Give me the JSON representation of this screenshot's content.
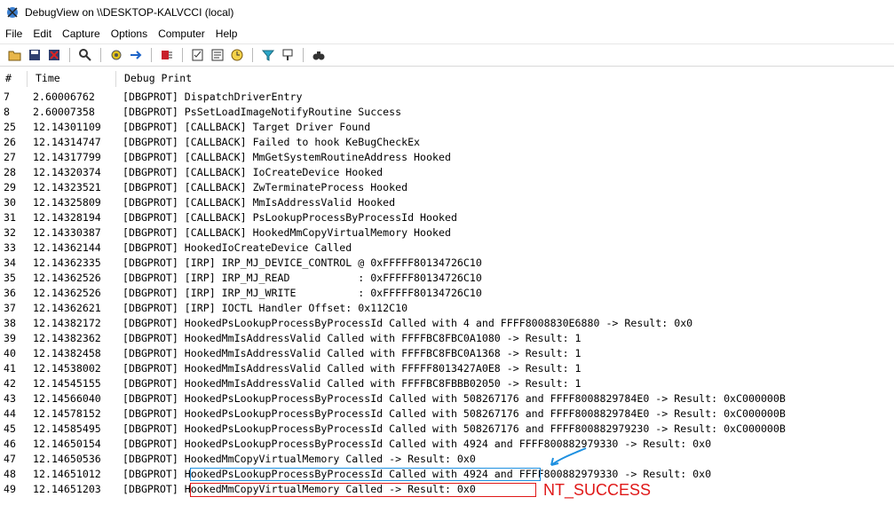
{
  "window": {
    "title": "DebugView on \\\\DESKTOP-KALVCCI (local)"
  },
  "menu": [
    "File",
    "Edit",
    "Capture",
    "Options",
    "Computer",
    "Help"
  ],
  "toolbar_icons": [
    "open-icon",
    "save-icon",
    "clear-icon",
    "find-icon",
    "capture-icon",
    "autoscroll-icon",
    "capture-kernel-icon",
    "clock-icon",
    "filter-icon",
    "highlight-icon",
    "binoculars-icon"
  ],
  "columns": {
    "num": "#",
    "time": "Time",
    "msg": "Debug Print"
  },
  "rows": [
    {
      "n": "7",
      "t": "2.60006762",
      "m": "[DBGPROT] DispatchDriverEntry"
    },
    {
      "n": "8",
      "t": "2.60007358",
      "m": "[DBGPROT] PsSetLoadImageNotifyRoutine Success"
    },
    {
      "n": "25",
      "t": "12.14301109",
      "m": "[DBGPROT] [CALLBACK] Target Driver Found"
    },
    {
      "n": "26",
      "t": "12.14314747",
      "m": "[DBGPROT] [CALLBACK] Failed to hook KeBugCheckEx"
    },
    {
      "n": "27",
      "t": "12.14317799",
      "m": "[DBGPROT] [CALLBACK] MmGetSystemRoutineAddress Hooked"
    },
    {
      "n": "28",
      "t": "12.14320374",
      "m": "[DBGPROT] [CALLBACK] IoCreateDevice Hooked"
    },
    {
      "n": "29",
      "t": "12.14323521",
      "m": "[DBGPROT] [CALLBACK] ZwTerminateProcess Hooked"
    },
    {
      "n": "30",
      "t": "12.14325809",
      "m": "[DBGPROT] [CALLBACK] MmIsAddressValid Hooked"
    },
    {
      "n": "31",
      "t": "12.14328194",
      "m": "[DBGPROT] [CALLBACK] PsLookupProcessByProcessId Hooked"
    },
    {
      "n": "32",
      "t": "12.14330387",
      "m": "[DBGPROT] [CALLBACK] HookedMmCopyVirtualMemory Hooked"
    },
    {
      "n": "33",
      "t": "12.14362144",
      "m": "[DBGPROT] HookedIoCreateDevice Called"
    },
    {
      "n": "34",
      "t": "12.14362335",
      "m": "[DBGPROT] [IRP] IRP_MJ_DEVICE_CONTROL @ 0xFFFFF80134726C10"
    },
    {
      "n": "35",
      "t": "12.14362526",
      "m": "[DBGPROT] [IRP] IRP_MJ_READ           : 0xFFFFF80134726C10"
    },
    {
      "n": "36",
      "t": "12.14362526",
      "m": "[DBGPROT] [IRP] IRP_MJ_WRITE          : 0xFFFFF80134726C10"
    },
    {
      "n": "37",
      "t": "12.14362621",
      "m": "[DBGPROT] [IRP] IOCTL Handler Offset: 0x112C10"
    },
    {
      "n": "38",
      "t": "12.14382172",
      "m": "[DBGPROT] HookedPsLookupProcessByProcessId Called with 4 and FFFF8008830E6880 -> Result: 0x0"
    },
    {
      "n": "39",
      "t": "12.14382362",
      "m": "[DBGPROT] HookedMmIsAddressValid Called with FFFFBC8FBC0A1080 -> Result: 1"
    },
    {
      "n": "40",
      "t": "12.14382458",
      "m": "[DBGPROT] HookedMmIsAddressValid Called with FFFFBC8FBC0A1368 -> Result: 1"
    },
    {
      "n": "41",
      "t": "12.14538002",
      "m": "[DBGPROT] HookedMmIsAddressValid Called with FFFFF8013427A0E8 -> Result: 1"
    },
    {
      "n": "42",
      "t": "12.14545155",
      "m": "[DBGPROT] HookedMmIsAddressValid Called with FFFFBC8FBBB02050 -> Result: 1"
    },
    {
      "n": "43",
      "t": "12.14566040",
      "m": "[DBGPROT] HookedPsLookupProcessByProcessId Called with 508267176 and FFFF8008829784E0 -> Result: 0xC000000B"
    },
    {
      "n": "44",
      "t": "12.14578152",
      "m": "[DBGPROT] HookedPsLookupProcessByProcessId Called with 508267176 and FFFF8008829784E0 -> Result: 0xC000000B"
    },
    {
      "n": "45",
      "t": "12.14585495",
      "m": "[DBGPROT] HookedPsLookupProcessByProcessId Called with 508267176 and FFFF800882979230 -> Result: 0xC000000B"
    },
    {
      "n": "46",
      "t": "12.14650154",
      "m": "[DBGPROT] HookedPsLookupProcessByProcessId Called with 4924 and FFFF800882979330 -> Result: 0x0"
    },
    {
      "n": "47",
      "t": "12.14650536",
      "m": "[DBGPROT] HookedMmCopyVirtualMemory Called -> Result: 0x0"
    },
    {
      "n": "48",
      "t": "12.14651012",
      "m": "[DBGPROT] HookedPsLookupProcessByProcessId Called with 4924 and FFFF800882979330 -> Result: 0x0"
    },
    {
      "n": "49",
      "t": "12.14651203",
      "m": "[DBGPROT] HookedMmCopyVirtualMemory Called -> Result: 0x0"
    }
  ],
  "annotation": {
    "text": "NT_SUCCESS",
    "color": "#e01818",
    "highlight_blue": "#1e90e0"
  }
}
